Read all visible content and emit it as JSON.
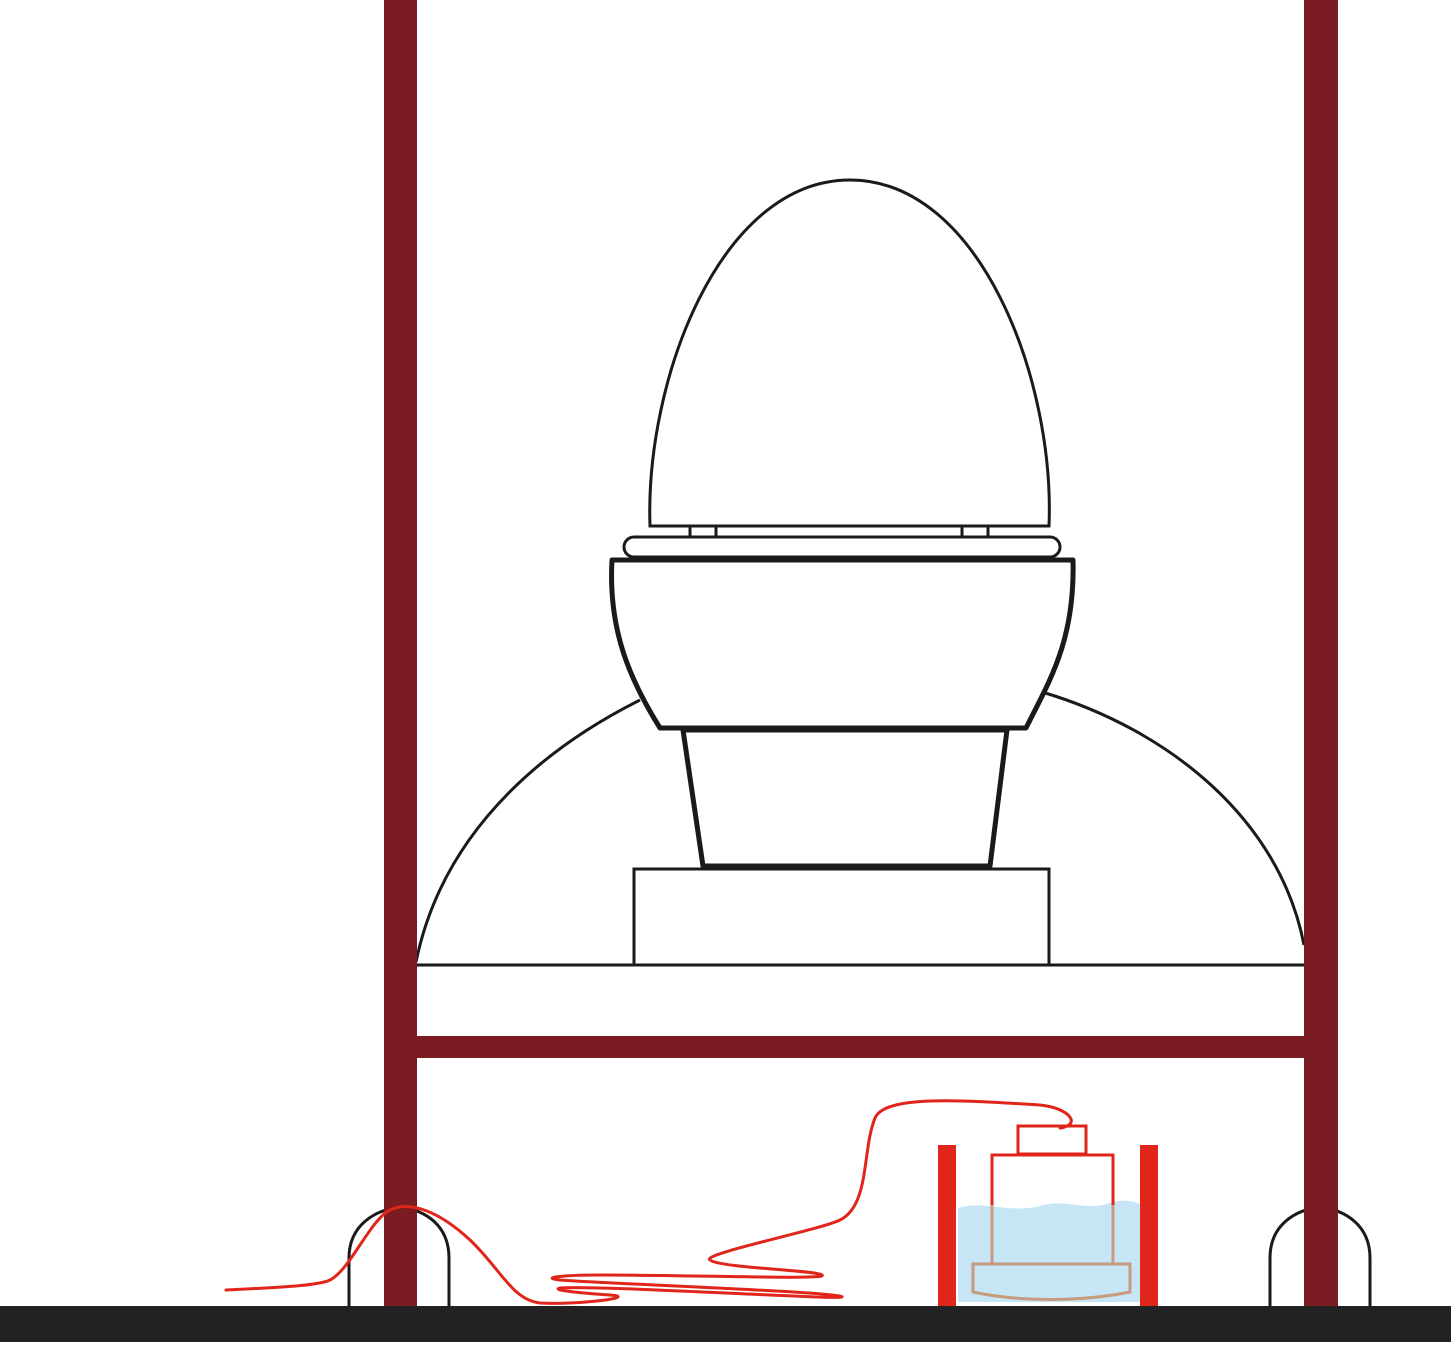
{
  "diagram": {
    "description_free": true,
    "colors": {
      "background": "#ffffff",
      "frame": "#7a1c22",
      "outline": "#1a1a1a",
      "floor": "#222222",
      "cable": "#e0251b",
      "water": "#c6e6f5",
      "tank_base": "#c89a7e",
      "tank_walls": "#e0251b"
    },
    "components": [
      {
        "id": "egg-lid"
      },
      {
        "id": "seat-rim"
      },
      {
        "id": "bowl"
      },
      {
        "id": "pedestal"
      },
      {
        "id": "plinth"
      },
      {
        "id": "dome"
      },
      {
        "id": "shelf"
      },
      {
        "id": "frame-left-post"
      },
      {
        "id": "frame-right-post"
      },
      {
        "id": "frame-crossbar"
      },
      {
        "id": "left-foot"
      },
      {
        "id": "right-foot"
      },
      {
        "id": "floor"
      },
      {
        "id": "sensor-cable"
      },
      {
        "id": "water-tank"
      },
      {
        "id": "sensor-device"
      }
    ]
  }
}
